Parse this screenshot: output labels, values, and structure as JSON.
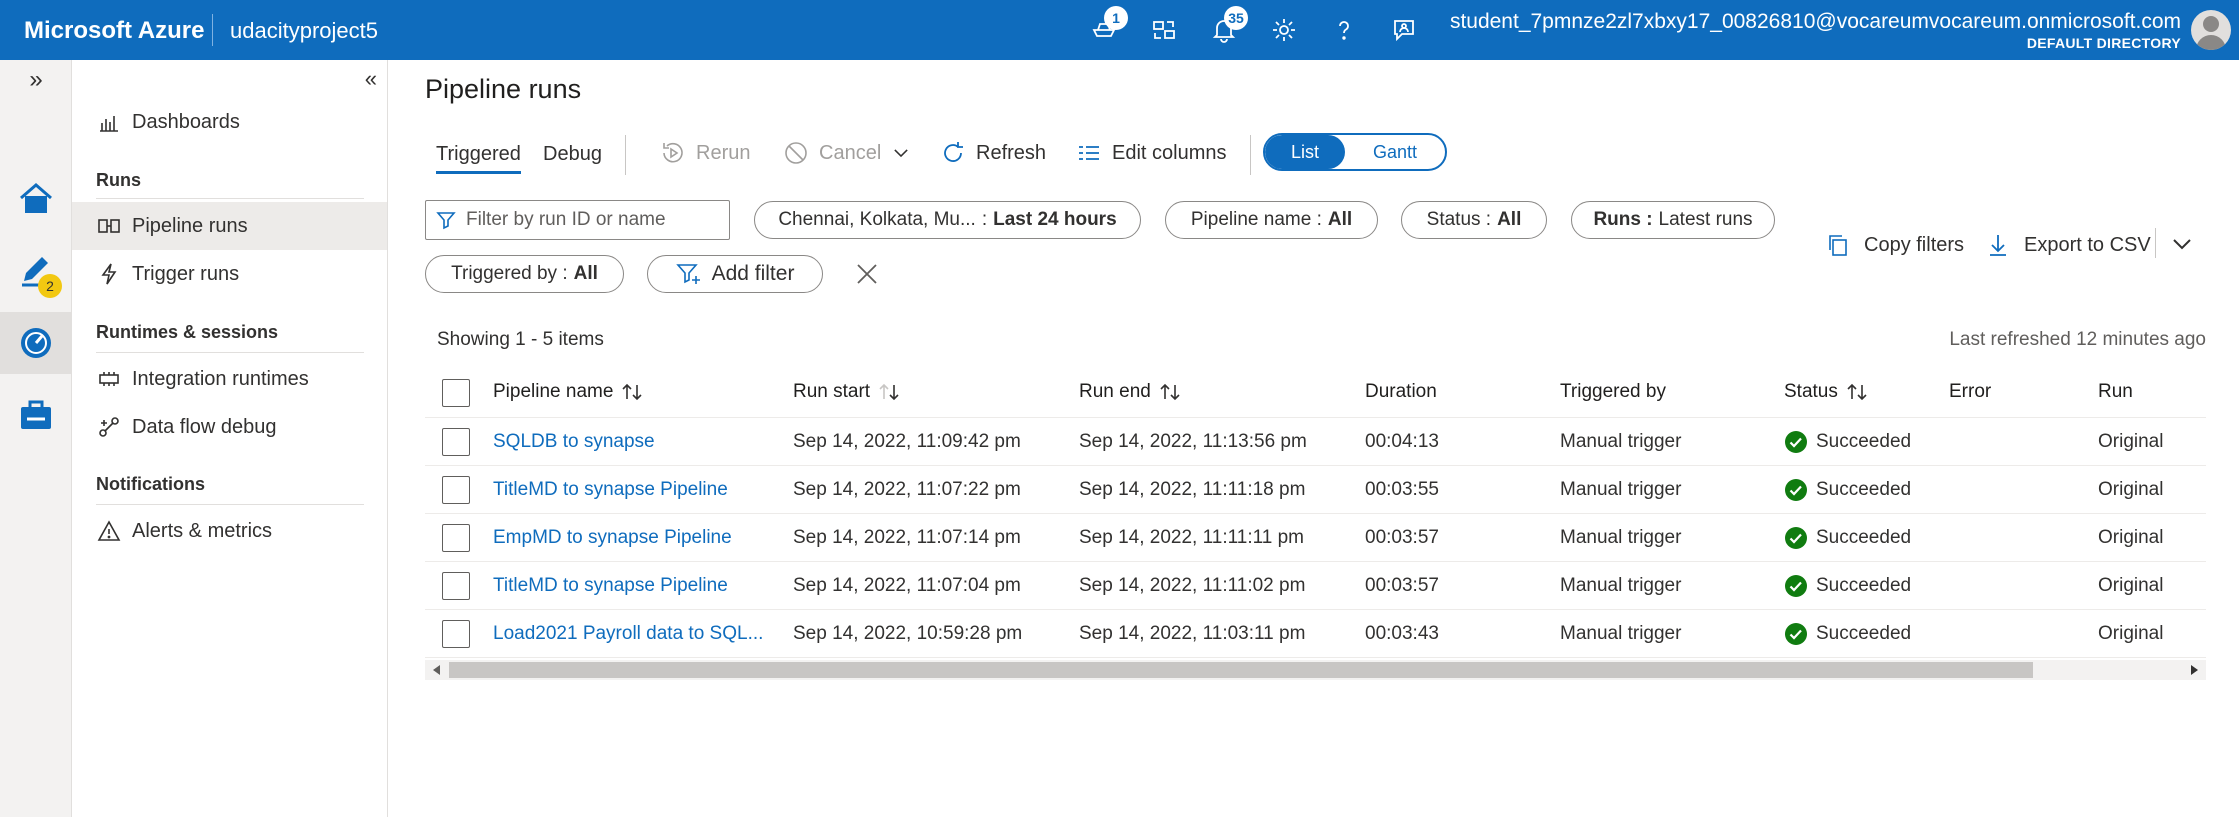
{
  "header": {
    "brand": "Microsoft Azure",
    "workspace": "udacityproject5",
    "icons": [
      {
        "name": "feedback-icon",
        "badge": "1"
      },
      {
        "name": "directory-switch-icon",
        "badge": ""
      },
      {
        "name": "notifications-icon",
        "badge": "35"
      },
      {
        "name": "settings-icon",
        "badge": ""
      },
      {
        "name": "help-icon",
        "badge": ""
      },
      {
        "name": "chat-feedback-icon",
        "badge": ""
      }
    ],
    "user_email": "student_7pmnze2zl7xbxy17_00826810@vocareumvocareum.onmicrosoft.com",
    "directory": "DEFAULT DIRECTORY"
  },
  "rail": {
    "expand": "»",
    "items": [
      {
        "name": "home-icon"
      },
      {
        "name": "develop-icon",
        "badge": "2"
      },
      {
        "name": "monitor-icon"
      },
      {
        "name": "manage-icon"
      }
    ]
  },
  "sidenav": {
    "collapse": "«",
    "items": {
      "dashboards": "Dashboards",
      "runs_section": "Runs",
      "pipeline_runs": "Pipeline runs",
      "trigger_runs": "Trigger runs",
      "runtimes_section": "Runtimes & sessions",
      "integration_runtimes": "Integration runtimes",
      "data_flow_debug": "Data flow debug",
      "notifications_section": "Notifications",
      "alerts_metrics": "Alerts & metrics"
    }
  },
  "main": {
    "title": "Pipeline runs",
    "tabs": {
      "triggered": "Triggered",
      "debug": "Debug"
    },
    "toolbar": {
      "rerun": "Rerun",
      "cancel": "Cancel",
      "refresh": "Refresh",
      "edit_columns": "Edit columns",
      "view_list": "List",
      "view_gantt": "Gantt"
    },
    "filters": {
      "search_placeholder": "Filter by run ID or name",
      "timezone_label": "Chennai, Kolkata, Mu...",
      "timezone_value": "Last 24 hours",
      "pipeline_name_label": "Pipeline name :",
      "pipeline_name_value": "All",
      "status_label": "Status :",
      "status_value": "All",
      "runs_label": "Runs :",
      "runs_value": "Latest runs",
      "triggered_by_label": "Triggered by :",
      "triggered_by_value": "All",
      "add_filter": "Add filter",
      "copy_filters": "Copy filters",
      "export_csv": "Export to CSV"
    },
    "showing": "Showing 1 - 5 items",
    "last_refreshed": "Last refreshed 12 minutes ago",
    "table": {
      "columns": {
        "pipeline_name": "Pipeline name",
        "run_start": "Run start",
        "run_end": "Run end",
        "duration": "Duration",
        "triggered_by": "Triggered by",
        "status": "Status",
        "error": "Error",
        "run": "Run"
      },
      "rows": [
        {
          "pipeline_name": "SQLDB to synapse",
          "run_start": "Sep 14, 2022, 11:09:42 pm",
          "run_end": "Sep 14, 2022, 11:13:56 pm",
          "duration": "00:04:13",
          "triggered_by": "Manual trigger",
          "status": "Succeeded",
          "error": "",
          "run": "Original"
        },
        {
          "pipeline_name": "TitleMD to synapse Pipeline",
          "run_start": "Sep 14, 2022, 11:07:22 pm",
          "run_end": "Sep 14, 2022, 11:11:18 pm",
          "duration": "00:03:55",
          "triggered_by": "Manual trigger",
          "status": "Succeeded",
          "error": "",
          "run": "Original"
        },
        {
          "pipeline_name": "EmpMD to synapse Pipeline",
          "run_start": "Sep 14, 2022, 11:07:14 pm",
          "run_end": "Sep 14, 2022, 11:11:11 pm",
          "duration": "00:03:57",
          "triggered_by": "Manual trigger",
          "status": "Succeeded",
          "error": "",
          "run": "Original"
        },
        {
          "pipeline_name": "TitleMD to synapse Pipeline",
          "run_start": "Sep 14, 2022, 11:07:04 pm",
          "run_end": "Sep 14, 2022, 11:11:02 pm",
          "duration": "00:03:57",
          "triggered_by": "Manual trigger",
          "status": "Succeeded",
          "error": "",
          "run": "Original"
        },
        {
          "pipeline_name": "Load2021 Payroll data to SQL...",
          "run_start": "Sep 14, 2022, 10:59:28 pm",
          "run_end": "Sep 14, 2022, 11:03:11 pm",
          "duration": "00:03:43",
          "triggered_by": "Manual trigger",
          "status": "Succeeded",
          "error": "",
          "run": "Original"
        }
      ]
    }
  },
  "colors": {
    "accent": "#0f6cbd",
    "success": "#107c10",
    "text": "#323130"
  }
}
